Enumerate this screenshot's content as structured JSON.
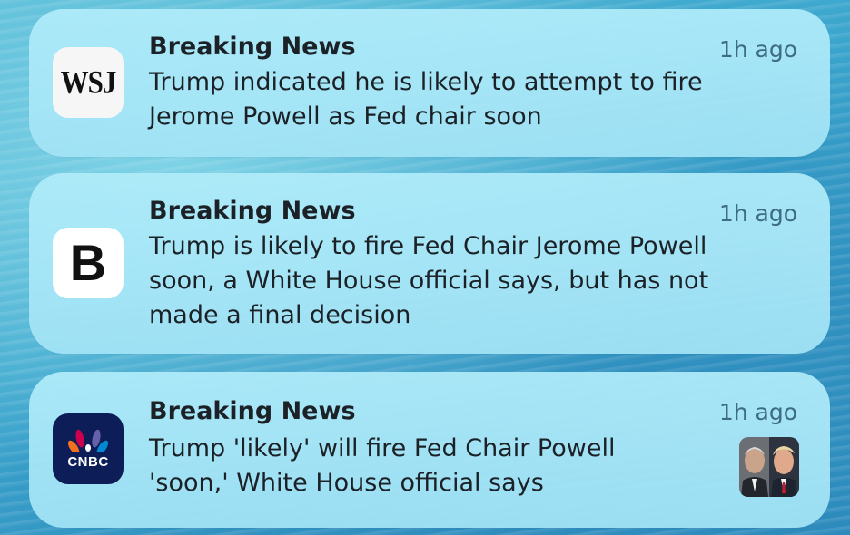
{
  "notifications": [
    {
      "app": "WSJ",
      "icon": "wsj-logo-icon",
      "title": "Breaking News",
      "time": "1h ago",
      "body_lines": [
        "Trump indicated he is likely to attempt to fire",
        "Jerome Powell as Fed chair soon"
      ]
    },
    {
      "app": "B",
      "icon": "bloomberg-logo-icon",
      "title": "Breaking News",
      "time": "1h ago",
      "body_lines": [
        "Trump is likely to fire Fed Chair Jerome Powell",
        "soon, a White House official says, but has not",
        "made a final decision"
      ]
    },
    {
      "app": "CNBC",
      "icon": "cnbc-peacock-logo-icon",
      "title": "Breaking News",
      "time": "1h ago",
      "body_lines": [
        "Trump 'likely' will fire Fed Chair Powell",
        "'soon,' White House official says"
      ],
      "thumbnail": "powell-trump-photo-thumbnail"
    }
  ],
  "colors": {
    "card_background": "#a9e6f8",
    "title_text": "#1b2126",
    "time_text": "#3d6b80",
    "cnbc_icon_background": "#0d1d57"
  }
}
